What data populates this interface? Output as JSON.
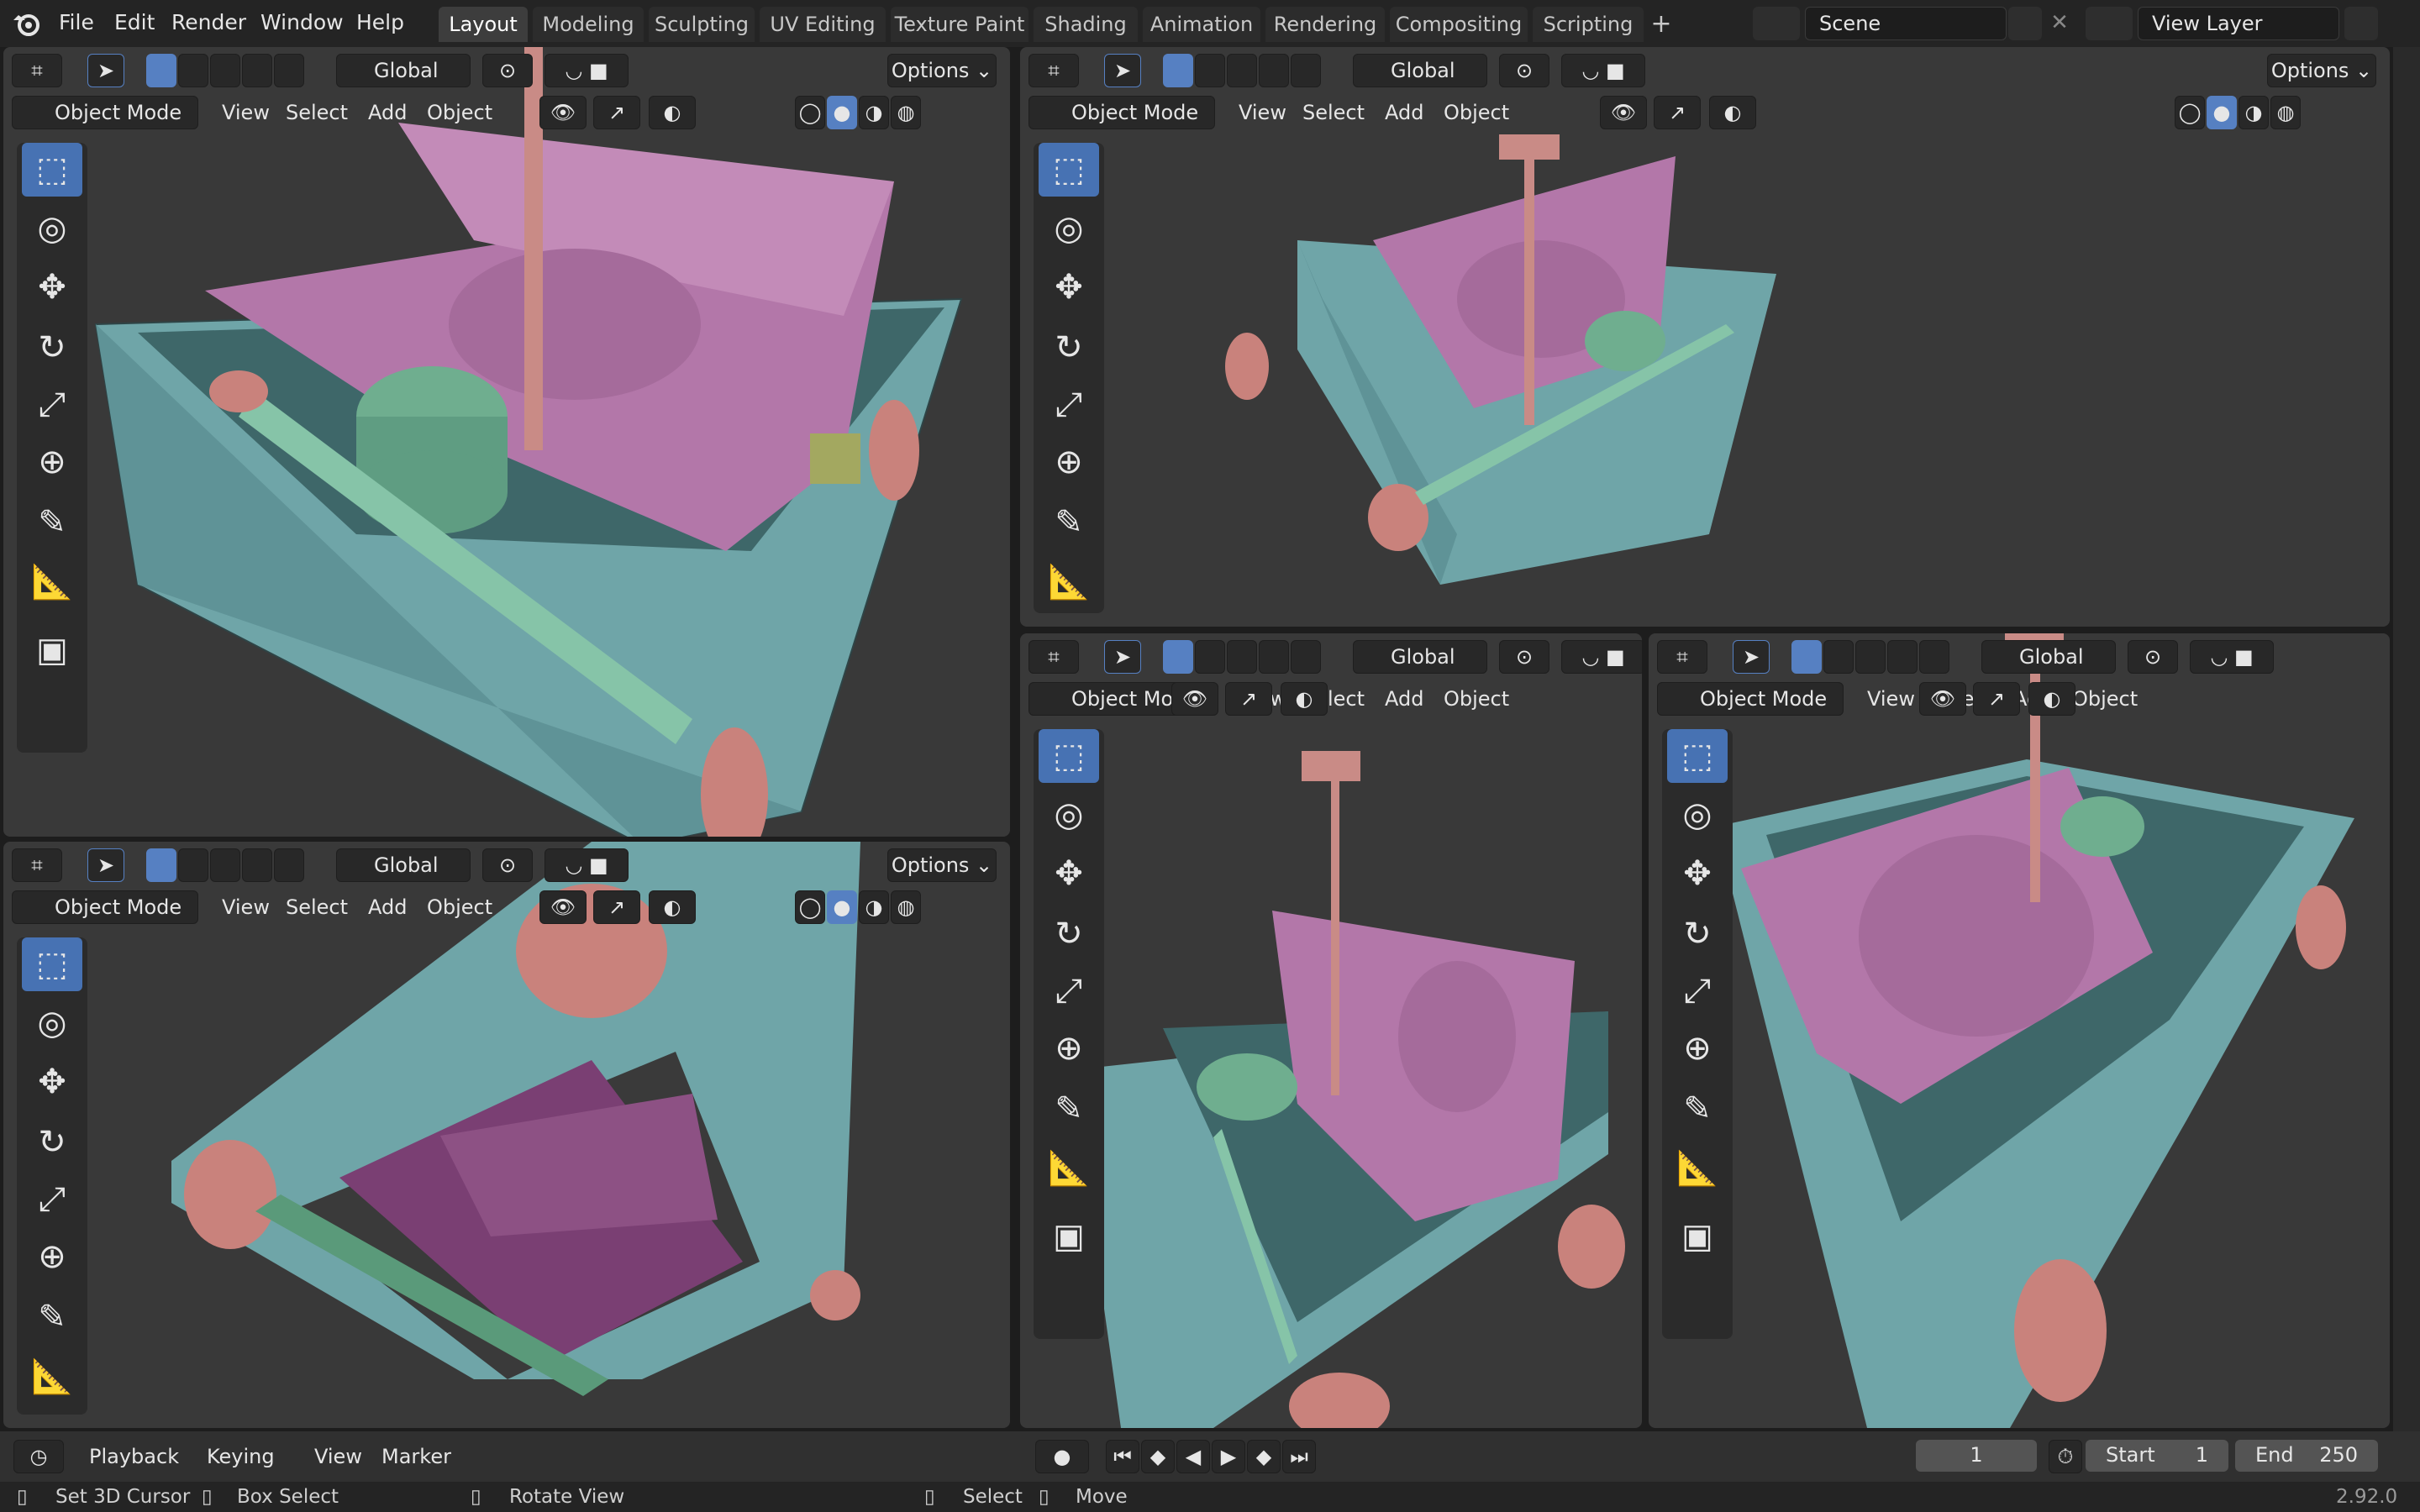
{
  "topbar": {
    "logo_icon": "blender-logo-icon",
    "menus": [
      "File",
      "Edit",
      "Render",
      "Window",
      "Help"
    ],
    "workspaces": [
      "Layout",
      "Modeling",
      "Sculpting",
      "UV Editing",
      "Texture Paint",
      "Shading",
      "Animation",
      "Rendering",
      "Compositing",
      "Scripting"
    ],
    "active_workspace": "Layout",
    "add_workspace": "+",
    "scene_name": "Scene",
    "view_layer_name": "View Layer"
  },
  "viewport": {
    "transform_orientation": "Global",
    "options_label": "Options",
    "mode_label": "Object Mode",
    "menu_view": "View",
    "menu_select": "Select",
    "menu_add": "Add",
    "menu_object": "Object"
  },
  "tools": [
    "select-box-icon",
    "cursor-icon",
    "move-icon",
    "rotate-icon",
    "scale-icon",
    "transform-icon",
    "annotate-icon",
    "measure-icon",
    "add-cube-icon"
  ],
  "timeline": {
    "playback": "Playback",
    "keying": "Keying",
    "view": "View",
    "marker": "Marker",
    "current_frame": "1",
    "start_label": "Start",
    "start_value": "1",
    "end_label": "End",
    "end_value": "250"
  },
  "statusbar": {
    "set_cursor": "Set 3D Cursor",
    "box_select": "Box Select",
    "rotate_view": "Rotate View",
    "select": "Select",
    "move": "Move",
    "version": "2.92.0"
  },
  "colors": {
    "base_teal": "#6fa5a8",
    "purple_mesh": "#b377a9",
    "green_mesh": "#6fae8f",
    "wheel_pink": "#c9827c",
    "select_blue": "#4772b3",
    "viewport_bg": "#393939"
  }
}
